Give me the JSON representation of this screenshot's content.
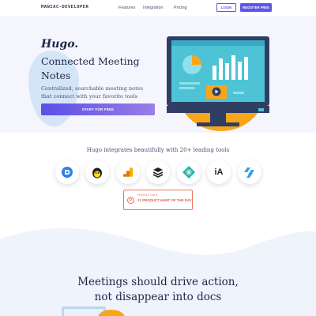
{
  "nav": {
    "brand": "MANIAC-DEVELOPER",
    "links": [
      "Features",
      "Integration",
      "Pricing"
    ],
    "login_label": "LOGIN",
    "register_label": "REGISTER FREE"
  },
  "hero": {
    "title": "Hugo.",
    "subtitle": "Connected Meeting Notes",
    "description": "Centralized, searchable meeting notes that connect with your favorite tools",
    "cta_label": "START FOR FREE"
  },
  "integrations": {
    "heading": "Hugo integrates beautifully with 20+ leading tools",
    "tools": [
      "discord-like-icon",
      "mailchimp-icon",
      "google-analytics-icon",
      "buffer-icon",
      "netlify-icon",
      "ia-writer-icon",
      "hubspot-icon"
    ],
    "ia_glyph": "iA"
  },
  "badge": {
    "category": "PRODUCT HUNT",
    "text": "#1 PRODUCT HUNT OF THE DAY",
    "logo_letter": "P"
  },
  "section": {
    "line1": "Meetings should drive action,",
    "line2": "not disappear into docs"
  },
  "colors": {
    "accent": "#5b57e8",
    "orange": "#f9a51a",
    "hero_bg": "#f5f6fd",
    "product_hunt": "#e8765a"
  }
}
